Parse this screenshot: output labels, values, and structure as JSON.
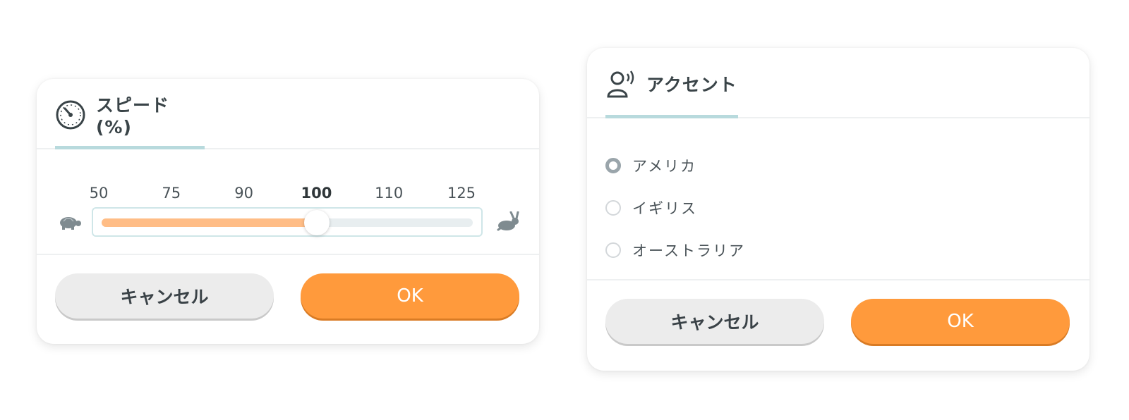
{
  "speed_dialog": {
    "title": "スピード (%)",
    "ticks": [
      {
        "label": "50",
        "bold": false
      },
      {
        "label": "75",
        "bold": false
      },
      {
        "label": "90",
        "bold": false
      },
      {
        "label": "100",
        "bold": true
      },
      {
        "label": "110",
        "bold": false
      },
      {
        "label": "125",
        "bold": false
      }
    ],
    "slider_value_fraction": 0.58,
    "cancel_label": "キャンセル",
    "ok_label": "OK",
    "colors": {
      "accent": "#ff9a3c",
      "fill": "#ffbd86",
      "tab_underline": "#b8dadd"
    },
    "icons": {
      "title": "speedometer-icon",
      "slow": "turtle-icon",
      "fast": "rabbit-icon"
    }
  },
  "accent_dialog": {
    "title": "アクセント",
    "options": [
      {
        "label": "アメリカ",
        "checked": true
      },
      {
        "label": "イギリス",
        "checked": false
      },
      {
        "label": "オーストラリア",
        "checked": false
      }
    ],
    "cancel_label": "キャンセル",
    "ok_label": "OK",
    "icons": {
      "title": "speaking-person-icon"
    }
  }
}
